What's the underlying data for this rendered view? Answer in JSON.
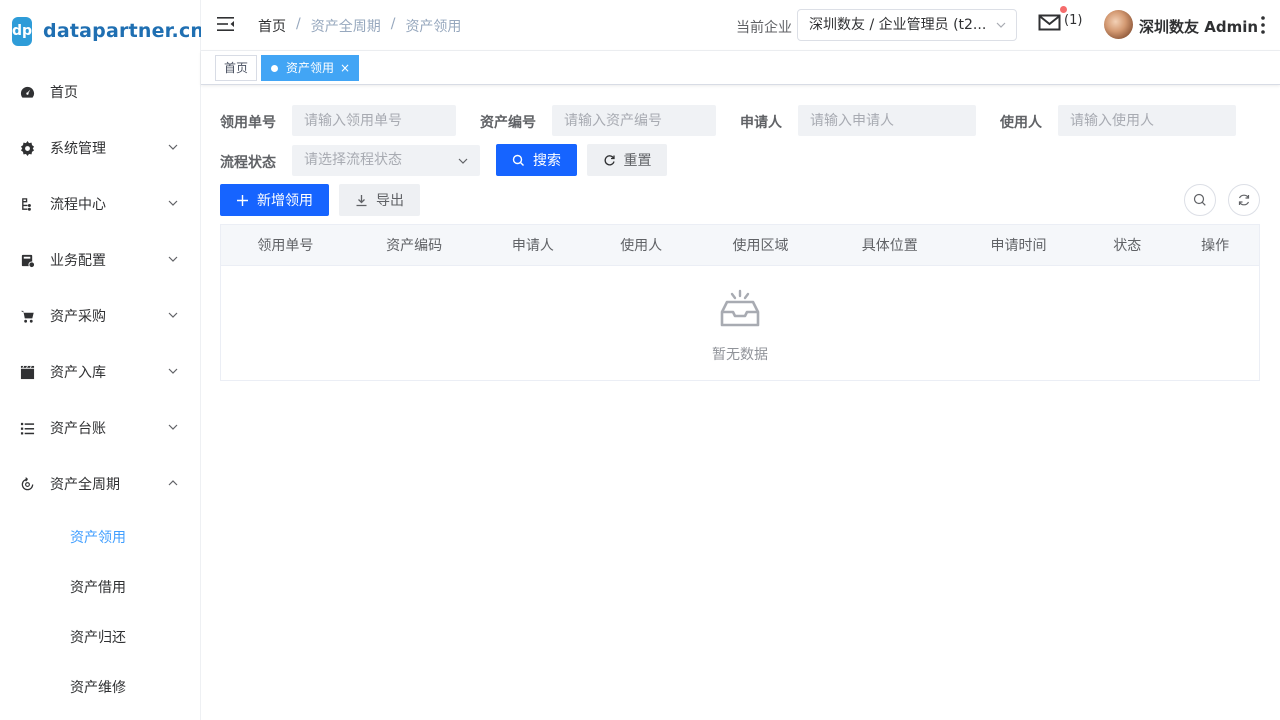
{
  "logo": {
    "mark": "dp",
    "text": "datapartner.cn"
  },
  "sidebar": {
    "items": [
      {
        "label": "首页",
        "icon": "dashboard-icon"
      },
      {
        "label": "系统管理",
        "icon": "gear-icon"
      },
      {
        "label": "流程中心",
        "icon": "flow-icon"
      },
      {
        "label": "业务配置",
        "icon": "config-icon"
      },
      {
        "label": "资产采购",
        "icon": "cart-icon"
      },
      {
        "label": "资产入库",
        "icon": "clapper-icon"
      },
      {
        "label": "资产台账",
        "icon": "list-icon"
      },
      {
        "label": "资产全周期",
        "icon": "cycle-icon"
      }
    ],
    "sub_items": [
      {
        "label": "资产领用",
        "active": true
      },
      {
        "label": "资产借用",
        "active": false
      },
      {
        "label": "资产归还",
        "active": false
      },
      {
        "label": "资产维修",
        "active": false
      }
    ]
  },
  "header": {
    "breadcrumb": [
      "首页",
      "资产全周期",
      "资产领用"
    ],
    "breadcrumb_sep": "/",
    "company_label": "当前企业",
    "company_value": "深圳数友 / 企业管理员 (t2...",
    "mail_count": "(1)",
    "username": "深圳数友 Admin"
  },
  "tags": {
    "home": "首页",
    "active": "资产领用",
    "close": "×"
  },
  "filters": {
    "order_no": {
      "label": "领用单号",
      "placeholder": "请输入领用单号"
    },
    "asset_no": {
      "label": "资产编号",
      "placeholder": "请输入资产编号"
    },
    "applicant": {
      "label": "申请人",
      "placeholder": "请输入申请人"
    },
    "user": {
      "label": "使用人",
      "placeholder": "请输入使用人"
    },
    "status": {
      "label": "流程状态",
      "placeholder": "请选择流程状态"
    }
  },
  "buttons": {
    "search": "搜索",
    "reset": "重置",
    "add": "新增领用",
    "export": "导出"
  },
  "table": {
    "columns": [
      "领用单号",
      "资产编码",
      "申请人",
      "使用人",
      "使用区域",
      "具体位置",
      "申请时间",
      "状态",
      "操作"
    ],
    "empty_text": "暂无数据"
  },
  "colors": {
    "primary": "#1664ff",
    "tag_active": "#42a5f5",
    "menu_active": "#409eff",
    "logo": "#2e9cd8",
    "badge": "#f56c6c"
  }
}
